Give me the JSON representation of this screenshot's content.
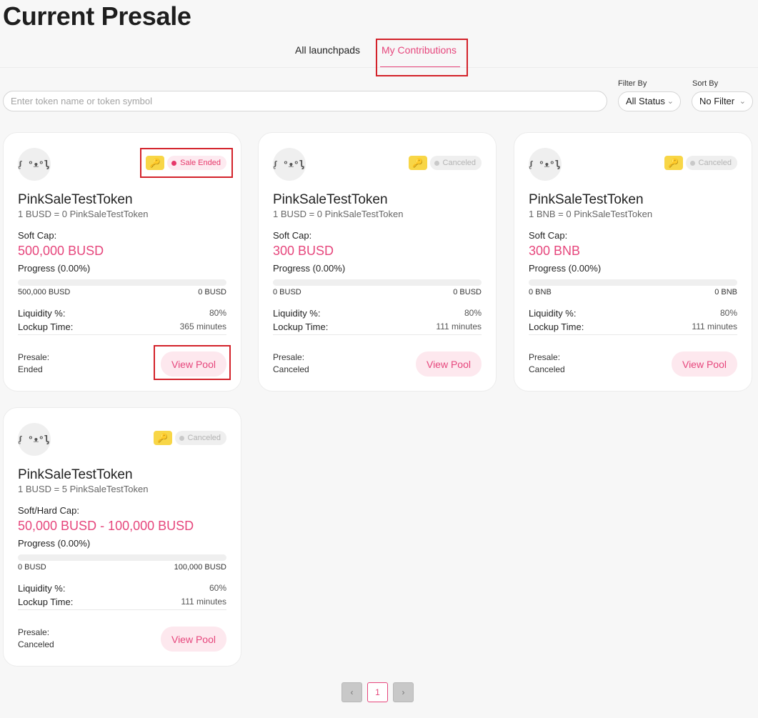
{
  "page": {
    "title": "Current Presale"
  },
  "tabs": [
    {
      "label": "All launchpads",
      "active": false
    },
    {
      "label": "My Contributions",
      "active": true
    }
  ],
  "search": {
    "placeholder": "Enter token name or token symbol",
    "value": ""
  },
  "filter": {
    "label": "Filter By",
    "value": "All Status"
  },
  "sort": {
    "label": "Sort By",
    "value": "No Filter"
  },
  "icons": {
    "chevron": "chevron-down-icon",
    "key": "key-icon",
    "avatar": "token-logo"
  },
  "colors": {
    "accent": "#e6467c",
    "key_badge": "#f8d647",
    "highlight_box": "#d3222a"
  },
  "cards": [
    {
      "avatar_text": "ᶘ ᵒᴥᵒᶅ",
      "status": "Sale Ended",
      "status_type": "ended",
      "name": "PinkSaleTestToken",
      "rate": "1 BUSD = 0 PinkSaleTestToken",
      "cap_label": "Soft Cap:",
      "cap_value": "500,000 BUSD",
      "progress_label": "Progress (0.00%)",
      "progress_fraction": 0.0,
      "bar_left": "500,000 BUSD",
      "bar_right": "0 BUSD",
      "liquidity_label": "Liquidity %:",
      "liquidity_value": "80%",
      "lockup_label": "Lockup Time:",
      "lockup_value": "365 minutes",
      "presale_label": "Presale:",
      "presale_status": "Ended",
      "button": "View Pool"
    },
    {
      "avatar_text": "ᶘ ᵒᴥᵒᶅ",
      "status": "Canceled",
      "status_type": "canceled",
      "name": "PinkSaleTestToken",
      "rate": "1 BUSD = 0 PinkSaleTestToken",
      "cap_label": "Soft Cap:",
      "cap_value": "300 BUSD",
      "progress_label": "Progress (0.00%)",
      "progress_fraction": 0.0,
      "bar_left": "0 BUSD",
      "bar_right": "0 BUSD",
      "liquidity_label": "Liquidity %:",
      "liquidity_value": "80%",
      "lockup_label": "Lockup Time:",
      "lockup_value": "111 minutes",
      "presale_label": "Presale:",
      "presale_status": "Canceled",
      "button": "View Pool"
    },
    {
      "avatar_text": "ᶘ ᵒᴥᵒᶅ",
      "status": "Canceled",
      "status_type": "canceled",
      "name": "PinkSaleTestToken",
      "rate": "1 BNB = 0 PinkSaleTestToken",
      "cap_label": "Soft Cap:",
      "cap_value": "300 BNB",
      "progress_label": "Progress (0.00%)",
      "progress_fraction": 0.0,
      "bar_left": "0 BNB",
      "bar_right": "0 BNB",
      "liquidity_label": "Liquidity %:",
      "liquidity_value": "80%",
      "lockup_label": "Lockup Time:",
      "lockup_value": "111 minutes",
      "presale_label": "Presale:",
      "presale_status": "Canceled",
      "button": "View Pool"
    },
    {
      "avatar_text": "ᶘ ᵒᴥᵒᶅ",
      "status": "Canceled",
      "status_type": "canceled",
      "name": "PinkSaleTestToken",
      "rate": "1 BUSD = 5 PinkSaleTestToken",
      "cap_label": "Soft/Hard Cap:",
      "cap_value": "50,000 BUSD - 100,000 BUSD",
      "progress_label": "Progress (0.00%)",
      "progress_fraction": 0.0,
      "bar_left": "0 BUSD",
      "bar_right": "100,000 BUSD",
      "liquidity_label": "Liquidity %:",
      "liquidity_value": "60%",
      "lockup_label": "Lockup Time:",
      "lockup_value": "111 minutes",
      "presale_label": "Presale:",
      "presale_status": "Canceled",
      "button": "View Pool"
    }
  ],
  "pagination": {
    "prev": "‹",
    "current": "1",
    "next": "›"
  }
}
